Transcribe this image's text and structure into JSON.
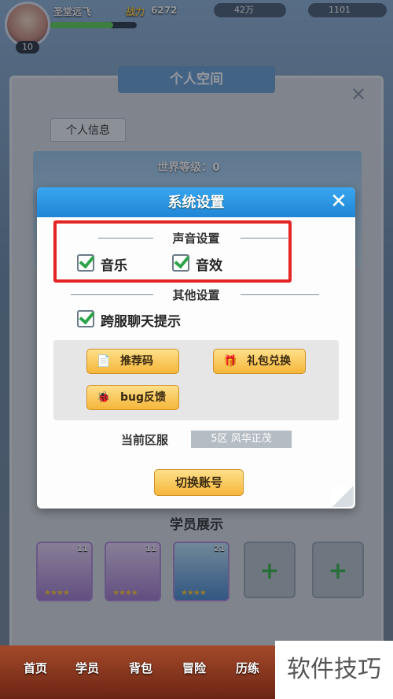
{
  "topbar": {
    "level": "10",
    "player_name": "圣堂远飞",
    "power_label": "战力",
    "power_value": "6272",
    "coins": "42万",
    "gems": "1101"
  },
  "panel": {
    "title": "个人空间",
    "tab_info": "个人信息",
    "world_level": "世界等级：0",
    "showcase_title": "学员展示",
    "cards": [
      {
        "num": "11"
      },
      {
        "num": "11"
      },
      {
        "num": "21"
      }
    ]
  },
  "dialog": {
    "title": "系统设置",
    "sound_section": "声音设置",
    "music_label": "音乐",
    "sfx_label": "音效",
    "other_section": "其他设置",
    "cross_chat_label": "跨服聊天提示",
    "btn_referral": "推荐码",
    "btn_gift": "礼包兑换",
    "btn_bug": "bug反馈",
    "server_label": "当前区服",
    "server_value": "5区 风华正茂",
    "switch_account": "切换账号"
  },
  "nav": {
    "home": "首页",
    "members": "学员",
    "bag": "背包",
    "adventure": "冒险",
    "training": "历练"
  },
  "watermark": "软件技巧"
}
